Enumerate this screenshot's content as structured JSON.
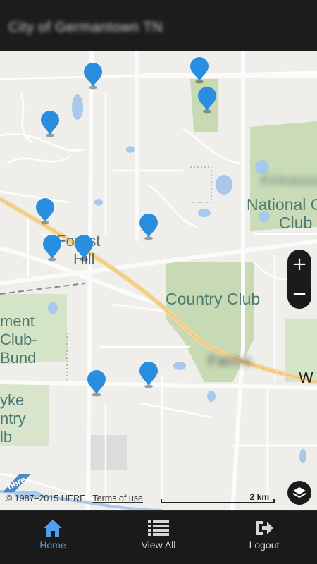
{
  "header": {
    "title": "City of Germantown TN"
  },
  "map": {
    "labels": {
      "forest": "Forest",
      "hill": "Hill",
      "country_club_center": "Country Club",
      "national_club_1": "National G",
      "national_club_2": "Club",
      "left_club_1": "ment",
      "left_club_2": "Club-",
      "left_club_3": "Bund",
      "left_club_4": "yke",
      "left_club_5": "ntry",
      "left_club_6": "lb",
      "road_letter": "W",
      "blurred_label_1": "Kirkwood",
      "blurred_label_2": "Farms"
    },
    "zoom": {
      "in_label": "+",
      "out_label": "−"
    },
    "attribution": {
      "copyright": "© 1987–2015 HERE | ",
      "terms": "Terms of use"
    },
    "scale": {
      "label": "2 km"
    },
    "marker_color": "#2a8ee0"
  },
  "nav": {
    "home": "Home",
    "view_all": "View All",
    "logout": "Logout",
    "active_color": "#4f9ff0"
  }
}
